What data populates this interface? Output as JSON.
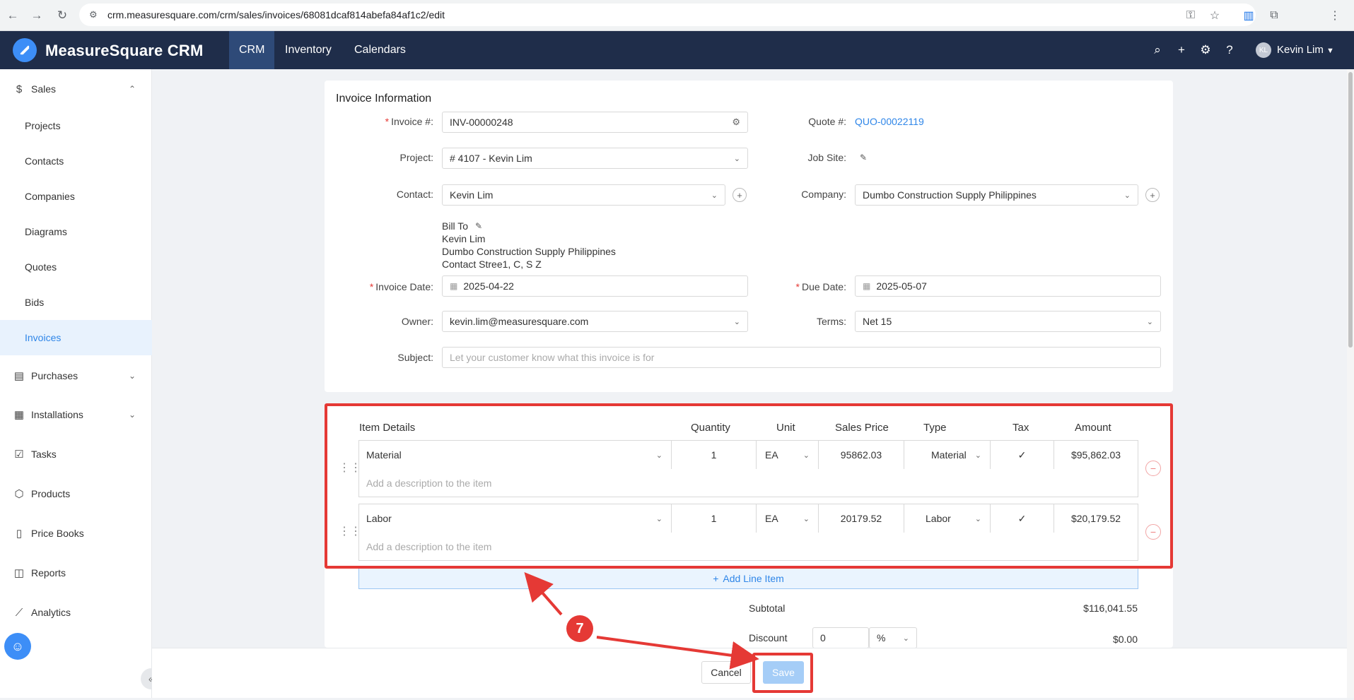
{
  "browser": {
    "url": "crm.measuresquare.com/crm/sales/invoices/68081dcaf814abefa84af1c2/edit"
  },
  "header": {
    "brand": "MeasureSquare CRM",
    "tabs": [
      "CRM",
      "Inventory",
      "Calendars"
    ],
    "active_tab": "CRM",
    "user_initials": "KL",
    "user_name": "Kevin Lim"
  },
  "sidebar": {
    "sales": "Sales",
    "sub_items": [
      "Projects",
      "Contacts",
      "Companies",
      "Diagrams",
      "Quotes",
      "Bids",
      "Invoices"
    ],
    "active_sub": "Invoices",
    "items": [
      "Purchases",
      "Installations",
      "Tasks",
      "Products",
      "Price Books",
      "Reports",
      "Analytics"
    ]
  },
  "form": {
    "section_title": "Invoice Information",
    "invoice_label": "Invoice #:",
    "invoice_value": "INV-00000248",
    "quote_label": "Quote #:",
    "quote_value": "QUO-00022119",
    "project_label": "Project:",
    "project_value": "# 4107 - Kevin Lim",
    "jobsite_label": "Job Site:",
    "contact_label": "Contact:",
    "contact_value": "Kevin Lim",
    "company_label": "Company:",
    "company_value": "Dumbo Construction Supply Philippines",
    "bill_to_label": "Bill To",
    "bill_to_lines": [
      "Kevin Lim",
      "Dumbo Construction Supply Philippines",
      "Contact Stree1, C, S Z"
    ],
    "invoice_date_label": "Invoice Date:",
    "invoice_date_value": "2025-04-22",
    "due_date_label": "Due Date:",
    "due_date_value": "2025-05-07",
    "owner_label": "Owner:",
    "owner_value": "kevin.lim@measuresquare.com",
    "terms_label": "Terms:",
    "terms_value": "Net 15",
    "subject_label": "Subject:",
    "subject_placeholder": "Let your customer know what this invoice is for"
  },
  "line_items": {
    "headers": [
      "Item Details",
      "Quantity",
      "Unit",
      "Sales Price",
      "Type",
      "Tax",
      "Amount"
    ],
    "rows": [
      {
        "item": "Material",
        "quantity": "1",
        "unit": "EA",
        "price": "95862.03",
        "type": "Material",
        "tax": "✓",
        "amount": "$95,862.03",
        "desc_placeholder": "Add a description to the item"
      },
      {
        "item": "Labor",
        "quantity": "1",
        "unit": "EA",
        "price": "20179.52",
        "type": "Labor",
        "tax": "✓",
        "amount": "$20,179.52",
        "desc_placeholder": "Add a description to the item"
      }
    ],
    "add_label": "Add Line Item"
  },
  "totals": {
    "subtotal_label": "Subtotal",
    "subtotal_value": "$116,041.55",
    "discount_label": "Discount",
    "discount_input": "0",
    "discount_unit": "%",
    "discount_value": "$0.00"
  },
  "footer": {
    "cancel": "Cancel",
    "save": "Save"
  },
  "annotation": {
    "step": "7",
    "color": "#e53935"
  }
}
